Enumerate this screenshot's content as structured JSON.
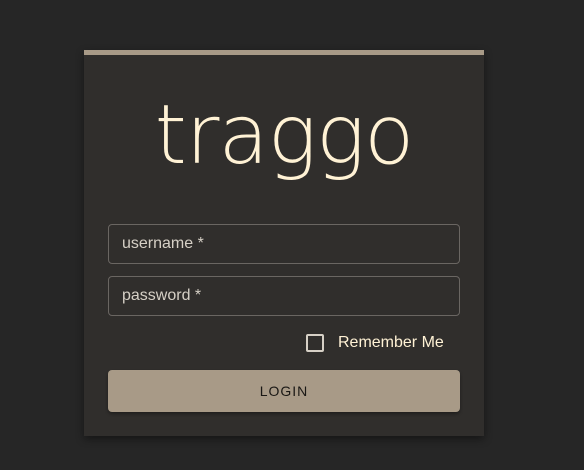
{
  "app": {
    "logo_text": "traggo"
  },
  "login_form": {
    "username_placeholder": "username *",
    "username_value": "",
    "password_placeholder": "password *",
    "password_value": "",
    "remember_label": "Remember Me",
    "remember_checked": false,
    "login_label": "LOGIN"
  },
  "colors": {
    "background": "#262626",
    "card": "#302e2c",
    "accent": "#a89a87",
    "logo": "#fff2d5"
  }
}
